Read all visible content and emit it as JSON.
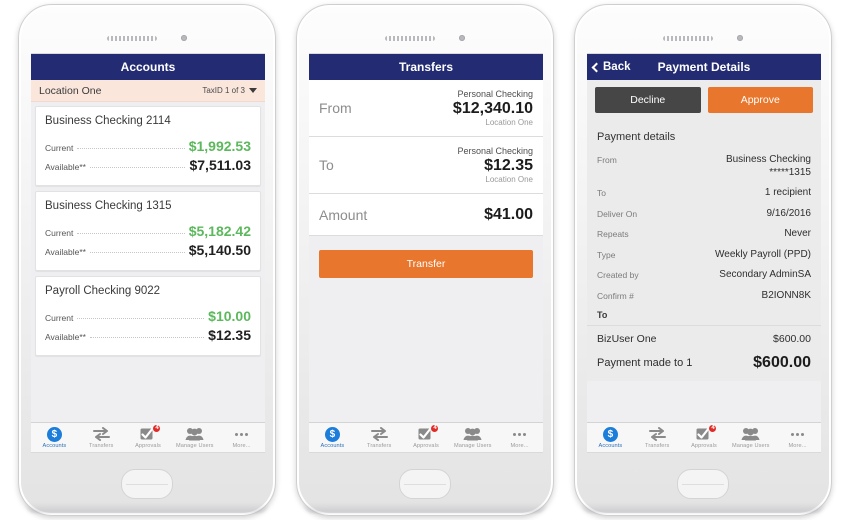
{
  "colors": {
    "navbar": "#232c72",
    "accent_orange": "#e8762c",
    "green": "#5cb85c",
    "badge_red": "#e02b27",
    "decline_grey": "#464646",
    "location_bar": "#fbe6dc",
    "tab_active": "#2d6fb8"
  },
  "tabbar": {
    "items": [
      {
        "label": "Accounts",
        "icon": "dollar-circle-icon",
        "active": true,
        "badge": ""
      },
      {
        "label": "Transfers",
        "icon": "transfer-arrows-icon",
        "active": false,
        "badge": ""
      },
      {
        "label": "Approvals",
        "icon": "checkmark-box-icon",
        "active": false,
        "badge": "4"
      },
      {
        "label": "Manage Users",
        "icon": "users-icon",
        "active": false,
        "badge": ""
      },
      {
        "label": "More...",
        "icon": "ellipsis-icon",
        "active": false,
        "badge": ""
      }
    ]
  },
  "accounts_screen": {
    "title": "Accounts",
    "location": {
      "name": "Location One",
      "taxid": "TaxID 1 of 3"
    },
    "current_label": "Current",
    "available_label": "Available**",
    "cards": [
      {
        "name": "Business Checking 2114",
        "current": "$1,992.53",
        "available": "$7,511.03"
      },
      {
        "name": "Business Checking 1315",
        "current": "$5,182.42",
        "available": "$5,140.50"
      },
      {
        "name": "Payroll Checking 9022",
        "current": "$10.00",
        "available": "$12.35"
      }
    ]
  },
  "transfers_screen": {
    "title": "Transfers",
    "rows": [
      {
        "label": "From",
        "account": "Personal Checking",
        "amount": "$12,340.10",
        "location": "Location One"
      },
      {
        "label": "To",
        "account": "Personal Checking",
        "amount": "$12.35",
        "location": "Location One"
      }
    ],
    "amount_row": {
      "label": "Amount",
      "amount": "$41.00"
    },
    "submit_label": "Transfer"
  },
  "payment_screen": {
    "title": "Payment Details",
    "back_label": "Back",
    "decline_label": "Decline",
    "approve_label": "Approve",
    "section_title": "Payment details",
    "details": [
      {
        "key": "From",
        "value": "Business Checking\n*****1315"
      },
      {
        "key": "To",
        "value": "1 recipient"
      },
      {
        "key": "Deliver On",
        "value": "9/16/2016"
      },
      {
        "key": "Repeats",
        "value": "Never"
      },
      {
        "key": "Type",
        "value": "Weekly Payroll (PPD)"
      },
      {
        "key": "Created by",
        "value": "Secondary AdminSA"
      },
      {
        "key": "Confirm #",
        "value": "B2IONN8K"
      }
    ],
    "recipients_header": "To",
    "recipients": [
      {
        "name": "BizUser One",
        "amount": "$600.00"
      }
    ],
    "total": {
      "label": "Payment made to 1",
      "amount": "$600.00"
    }
  }
}
